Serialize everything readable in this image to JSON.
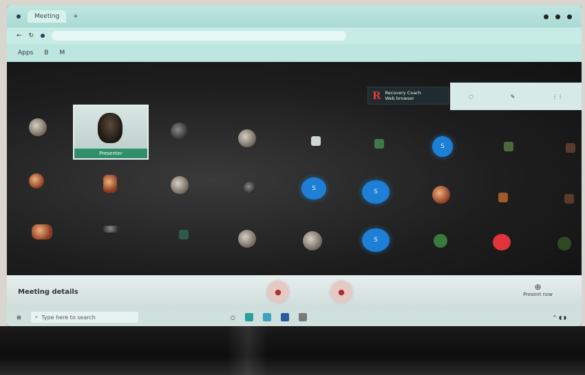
{
  "browser": {
    "tabs": [
      "Meeting"
    ],
    "url": "",
    "bookmarks": [
      "Apps",
      "B",
      "M"
    ]
  },
  "notification": {
    "logo": "R",
    "title": "Recovery Coach",
    "subtitle": "Web browser"
  },
  "top_panel": {
    "items": [
      "",
      "",
      ""
    ]
  },
  "presenter": {
    "name": "Presenter"
  },
  "participants": {
    "letter_tiles": [
      "S",
      "S",
      "S",
      "S"
    ]
  },
  "controls": {
    "meeting_label": "Meeting details",
    "share_label": "Present now"
  },
  "taskbar": {
    "search_placeholder": "Type here to search"
  },
  "colors": {
    "accent_blue": "#1d7fd6",
    "end_call_red": "#e0343a",
    "screen_bg": "#161616"
  }
}
